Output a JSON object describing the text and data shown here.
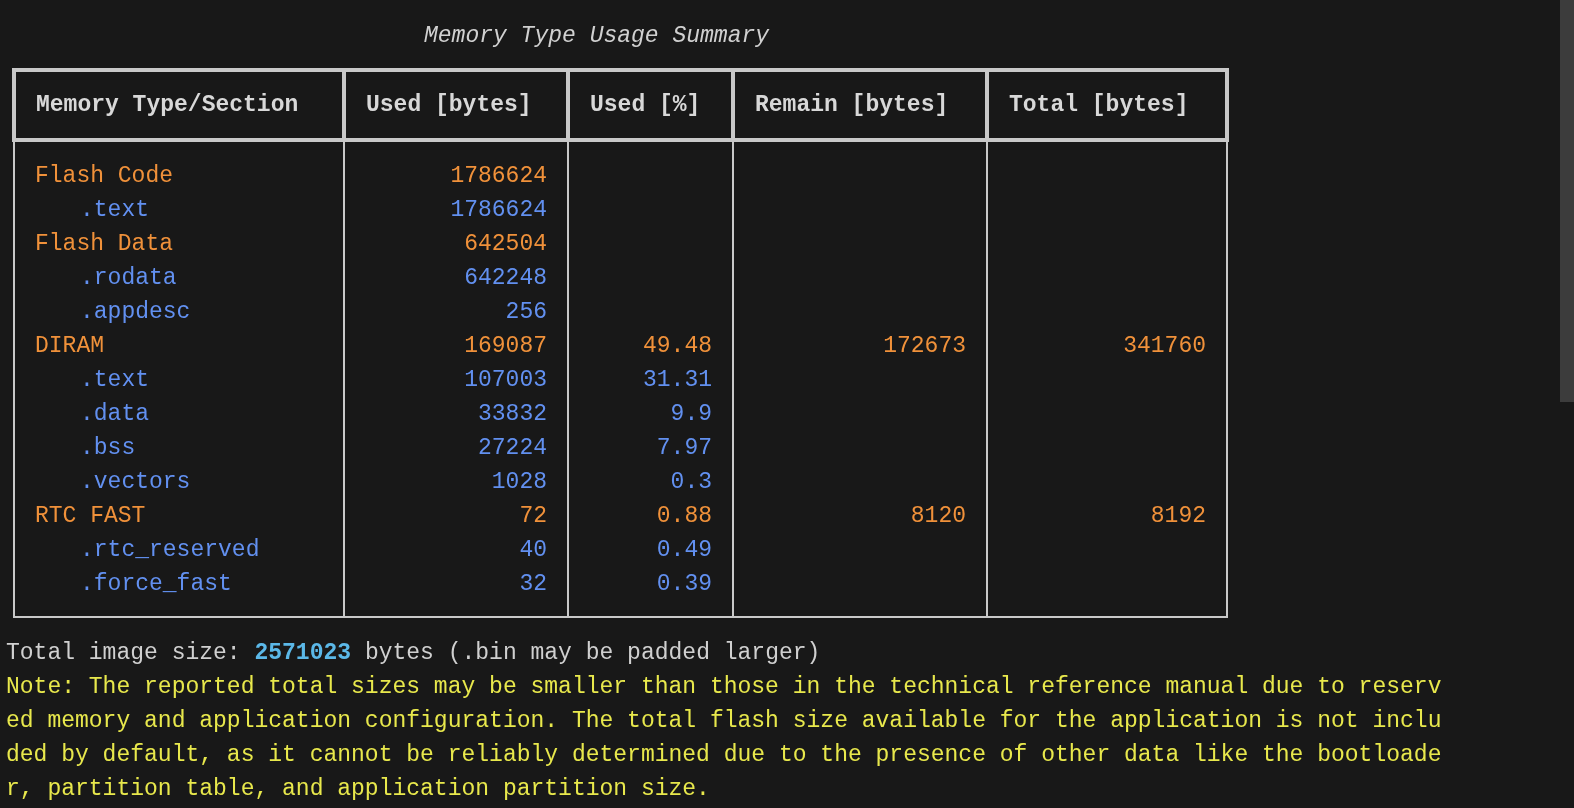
{
  "title": "Memory Type Usage Summary",
  "table": {
    "columns": [
      "Memory Type/Section",
      "Used [bytes]",
      "Used [%]",
      "Remain [bytes]",
      "Total [bytes]"
    ],
    "rows": [
      {
        "kind": "memory",
        "name": "Flash Code",
        "used": "1786624"
      },
      {
        "kind": "section",
        "name": ".text",
        "used": "1786624"
      },
      {
        "kind": "memory",
        "name": "Flash Data",
        "used": "642504"
      },
      {
        "kind": "section",
        "name": ".rodata",
        "used": "642248"
      },
      {
        "kind": "section",
        "name": ".appdesc",
        "used": "256"
      },
      {
        "kind": "memory",
        "name": "DIRAM",
        "used": "169087",
        "used_pct": "49.48",
        "remain": "172673",
        "total": "341760"
      },
      {
        "kind": "section",
        "name": ".text",
        "used": "107003",
        "used_pct": "31.31"
      },
      {
        "kind": "section",
        "name": ".data",
        "used": "33832",
        "used_pct": "9.9"
      },
      {
        "kind": "section",
        "name": ".bss",
        "used": "27224",
        "used_pct": "7.97"
      },
      {
        "kind": "section",
        "name": ".vectors",
        "used": "1028",
        "used_pct": "0.3"
      },
      {
        "kind": "memory",
        "name": "RTC FAST",
        "used": "72",
        "used_pct": "0.88",
        "remain": "8120",
        "total": "8192"
      },
      {
        "kind": "section",
        "name": ".rtc_reserved",
        "used": "40",
        "used_pct": "0.49"
      },
      {
        "kind": "section",
        "name": ".force_fast",
        "used": "32",
        "used_pct": "0.39"
      }
    ]
  },
  "total_line": "Total image size: **2571023** bytes (.bin may be padded larger)",
  "note": "Note: The reported total sizes may be smaller than those in the technical reference manual due to reserved memory and application configuration. The total flash size available for the application is not included by default, as it cannot be reliably determined due to the presence of other data like the bootloader, partition table, and application partition size."
}
